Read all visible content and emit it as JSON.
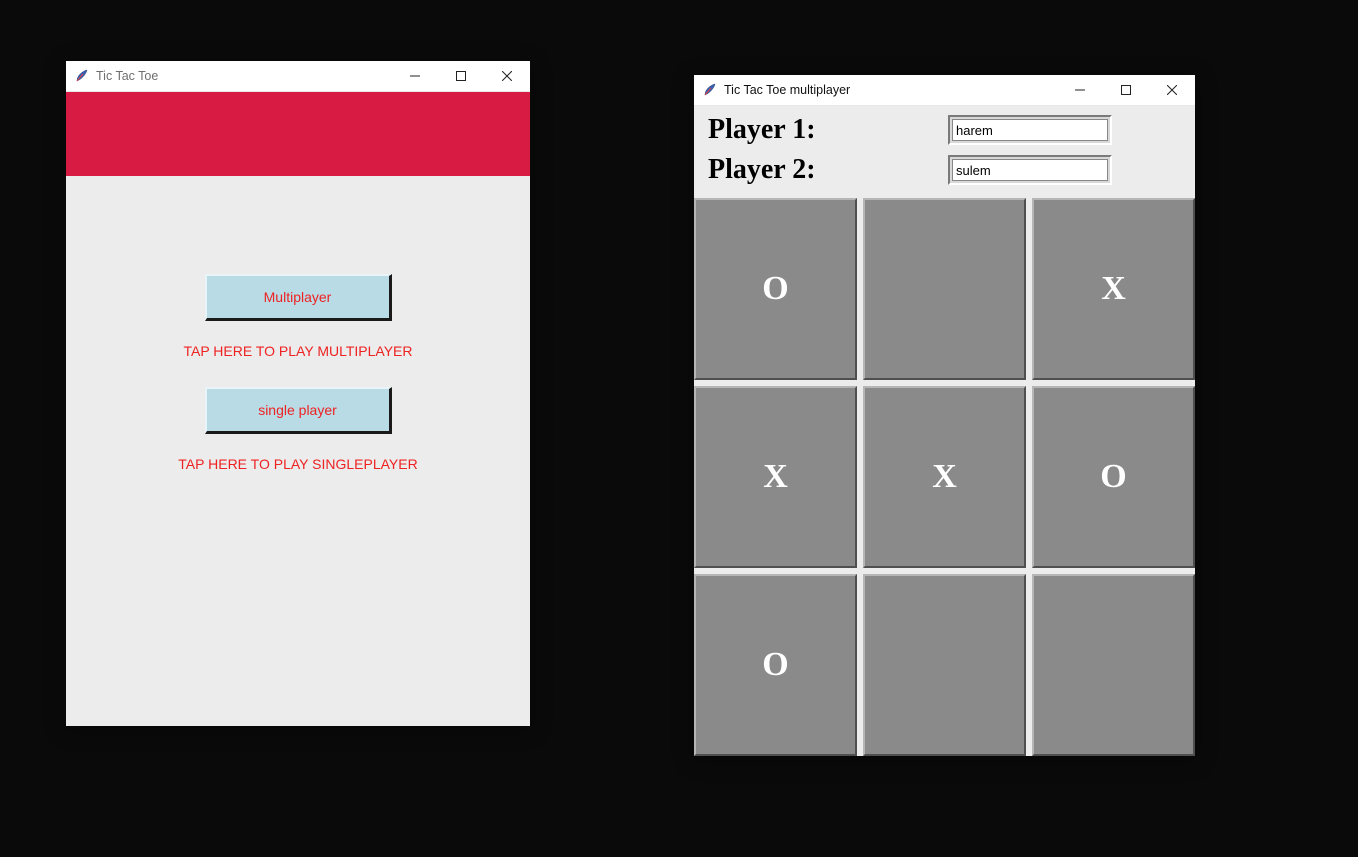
{
  "window1": {
    "title": "Tic Tac Toe",
    "buttons": {
      "multiplayer_label": "Multiplayer",
      "multiplayer_caption": "TAP HERE TO PLAY MULTIPLAYER",
      "singleplayer_label": "single player",
      "singleplayer_caption": "TAP HERE TO PLAY SINGLEPLAYER"
    }
  },
  "window2": {
    "title": "Tic Tac Toe multiplayer",
    "player1_label": "Player 1:",
    "player2_label": "Player 2:",
    "player1_value": "harem",
    "player2_value": "sulem",
    "board": {
      "c0": "O",
      "c1": "",
      "c2": "X",
      "c3": "X",
      "c4": "X",
      "c5": "O",
      "c6": "O",
      "c7": "",
      "c8": ""
    }
  }
}
